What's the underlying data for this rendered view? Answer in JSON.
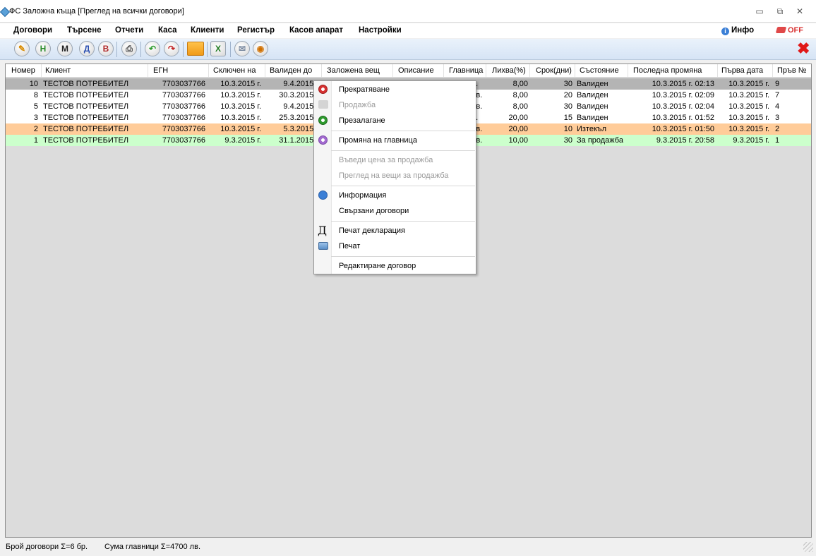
{
  "window": {
    "title": "ФС Заложна къща [Преглед на всички договори]",
    "minimize": "▭",
    "restore": "⧉",
    "close": "✕"
  },
  "menu": {
    "items": [
      "Договори",
      "Търсене",
      "Отчети",
      "Каса",
      "Клиенти",
      "Регистър",
      "Касов апарат",
      "Настройки"
    ],
    "info": "Инфо",
    "info_icon_glyph": "i",
    "off": "OFF"
  },
  "toolbar": {
    "buttons": [
      {
        "name": "edit-pencil-icon",
        "glyph": "✎",
        "color": "#d88b00"
      },
      {
        "name": "new-contract-h-button",
        "glyph": "Н",
        "color": "#2a8a2a"
      },
      {
        "name": "m-button",
        "glyph": "М",
        "color": "#222222"
      },
      {
        "name": "search-d-button",
        "glyph": "Д",
        "color": "#2b4fb0"
      },
      {
        "name": "search-v-button",
        "glyph": "В",
        "color": "#b02b2b"
      },
      {
        "name": "print-icon",
        "glyph": "⎙",
        "color": "#444444"
      },
      {
        "name": "undo-green-icon",
        "glyph": "↶",
        "color": "#2a9a2a"
      },
      {
        "name": "redo-red-icon",
        "glyph": "↷",
        "color": "#c02020"
      },
      {
        "name": "folder-icon",
        "glyph": "",
        "color": "#f2a324"
      },
      {
        "name": "export-excel-icon",
        "glyph": "X",
        "color": "#1f7a1f"
      },
      {
        "name": "mail-icon",
        "glyph": "✉",
        "color": "#7a8aa0"
      },
      {
        "name": "camera-icon",
        "glyph": "◉",
        "color": "#d07000"
      }
    ],
    "close_glyph": "✖"
  },
  "grid": {
    "headers": [
      "Номер",
      "Клиент",
      "ЕГН",
      "Сключен на",
      "Валиден до",
      "Заложена вещ",
      "Описание",
      "Главница",
      "Лихва(%)",
      "Срок(дни)",
      "Състояние",
      "Последна промяна",
      "Първа дата",
      "Пръв №"
    ],
    "rows": [
      {
        "num": "10",
        "client": "ТЕСТОВ ПОТРЕБИТЕЛ",
        "egn": "7703037766",
        "signed": "10.3.2015 г.",
        "valid": "9.4.2015 г.",
        "principal": "...",
        "interest": "8,00",
        "term": "30",
        "state": "Валиден",
        "changed": "10.3.2015 г. 02:13",
        "first_date": "10.3.2015 г.",
        "first_no": "9",
        "bg": "#b4b4b4"
      },
      {
        "num": "8",
        "client": "ТЕСТОВ ПОТРЕБИТЕЛ",
        "egn": "7703037766",
        "signed": "10.3.2015 г.",
        "valid": "30.3.2015 г.",
        "principal": "лв.",
        "interest": "8,00",
        "term": "20",
        "state": "Валиден",
        "changed": "10.3.2015 г. 02:09",
        "first_date": "10.3.2015 г.",
        "first_no": "7",
        "bg": "#ffffff"
      },
      {
        "num": "5",
        "client": "ТЕСТОВ ПОТРЕБИТЕЛ",
        "egn": "7703037766",
        "signed": "10.3.2015 г.",
        "valid": "9.4.2015 г.",
        "principal": "лв.",
        "interest": "8,00",
        "term": "30",
        "state": "Валиден",
        "changed": "10.3.2015 г. 02:04",
        "first_date": "10.3.2015 г.",
        "first_no": "4",
        "bg": "#ffffff"
      },
      {
        "num": "3",
        "client": "ТЕСТОВ ПОТРЕБИТЕЛ",
        "egn": "7703037766",
        "signed": "10.3.2015 г.",
        "valid": "25.3.2015 г.",
        "principal": "...",
        "interest": "20,00",
        "term": "15",
        "state": "Валиден",
        "changed": "10.3.2015 г. 01:52",
        "first_date": "10.3.2015 г.",
        "first_no": "3",
        "bg": "#ffffff"
      },
      {
        "num": "2",
        "client": "ТЕСТОВ ПОТРЕБИТЕЛ",
        "egn": "7703037766",
        "signed": "10.3.2015 г.",
        "valid": "5.3.2015 г.",
        "principal": "лв.",
        "interest": "20,00",
        "term": "10",
        "state": "Изтекъл",
        "changed": "10.3.2015 г. 01:50",
        "first_date": "10.3.2015 г.",
        "first_no": "2",
        "bg": "#ffcc99"
      },
      {
        "num": "1",
        "client": "ТЕСТОВ ПОТРЕБИТЕЛ",
        "egn": "7703037766",
        "signed": "9.3.2015 г.",
        "valid": "31.1.2015 г.",
        "principal": "лв.",
        "interest": "10,00",
        "term": "30",
        "state": "За продажба",
        "changed": "9.3.2015 г. 20:58",
        "first_date": "9.3.2015 г.",
        "first_no": "1",
        "bg": "#ccffcc"
      }
    ]
  },
  "context_menu": {
    "items": [
      {
        "label": "Прекратяване",
        "disabled": false,
        "icon": "stop-red-icon"
      },
      {
        "label": "Продажба",
        "disabled": true,
        "icon": "sale-gray-icon"
      },
      {
        "label": "Презалагане",
        "disabled": false,
        "icon": "repledge-green-icon"
      },
      {
        "label": "Промяна на главница",
        "disabled": false,
        "icon": "principal-purple-icon"
      },
      {
        "label": "Въведи цена за продажба",
        "disabled": true,
        "icon": ""
      },
      {
        "label": "Преглед на вещи за продажба",
        "disabled": true,
        "icon": ""
      },
      {
        "label": "Информация",
        "disabled": false,
        "icon": "info-icon"
      },
      {
        "label": "Свързани договори",
        "disabled": false,
        "icon": ""
      },
      {
        "label": "Печат декларация",
        "disabled": false,
        "icon": "declaration-d-icon"
      },
      {
        "label": "Печат",
        "disabled": false,
        "icon": "print-icon"
      },
      {
        "label": "Редактиране договор",
        "disabled": false,
        "icon": ""
      }
    ],
    "declaration_glyph": "Д"
  },
  "status": {
    "count": "Брой договори Σ=6 бр.",
    "sum": "Сума главници Σ=4700 лв."
  }
}
